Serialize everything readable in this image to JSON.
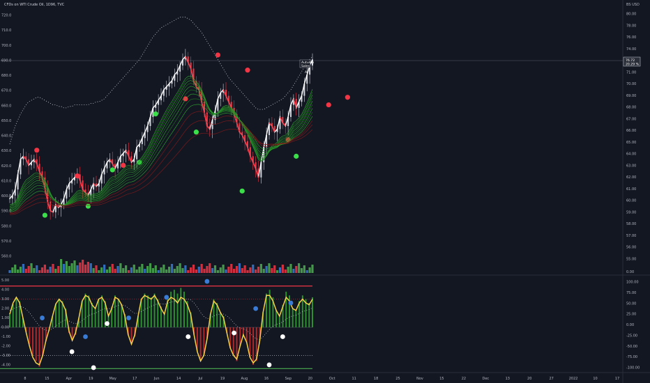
{
  "header": {
    "title": "CFDs on WTI Crude Oil, 1D96, TVC",
    "currency": "BS USD"
  },
  "price_tag": {
    "value": "76.72",
    "change": "20.29 %"
  },
  "annotation": {
    "line1": "Autumn",
    "line2": "Sales",
    "marker": "A"
  },
  "colors": {
    "background": "#131722",
    "price_line": "#ffffff",
    "bull_candle": "#4caf50",
    "bear_candle": "#f23645",
    "green_dot": "#3bdf4a",
    "red_dot": "#f23645",
    "blue_dot": "#3a7bd5",
    "oscillator_line": "#f5d24a",
    "hist_green": "#2e9e2e",
    "hist_red": "#c62828",
    "upper_band": "#f23645",
    "lower_band": "#4caf50"
  },
  "chart_data": [
    {
      "type": "line",
      "panel": "price",
      "ylim": [
        558,
        722
      ],
      "yticks_left": [
        "720.0",
        "710.0",
        "700.0",
        "690.0",
        "680.0",
        "670.0",
        "660.0",
        "650.0",
        "640.0",
        "630.0",
        "620.0",
        "610.0",
        "600.0",
        "590.0",
        "580.0",
        "570.0",
        "560.0"
      ],
      "yticks_right": [
        "80.00",
        "78.00",
        "76.00",
        "74.00",
        "72.00",
        "71.00",
        "70.00",
        "69.00",
        "68.00",
        "67.00",
        "66.00",
        "65.00",
        "64.00",
        "63.00",
        "62.00",
        "61.00",
        "60.00",
        "59.00",
        "58.00",
        "57.00",
        "56.00",
        "55.00"
      ],
      "price": [
        598,
        600,
        604,
        614,
        624,
        626,
        624,
        620,
        622,
        624,
        621,
        616,
        612,
        605,
        596,
        590,
        589,
        594,
        592,
        594,
        598,
        604,
        608,
        610,
        612,
        614,
        610,
        604,
        602,
        600,
        604,
        608,
        606,
        608,
        614,
        618,
        622,
        624,
        621,
        618,
        622,
        626,
        628,
        630,
        626,
        622,
        624,
        632,
        634,
        638,
        642,
        646,
        652,
        658,
        660,
        663,
        666,
        670,
        672,
        674,
        676,
        680,
        682,
        686,
        690,
        692,
        688,
        684,
        676,
        672,
        670,
        662,
        655,
        646,
        644,
        650,
        656,
        664,
        668,
        670,
        666,
        662,
        658,
        654,
        648,
        642,
        640,
        636,
        632,
        626,
        622,
        618,
        612,
        622,
        632,
        640,
        648,
        646,
        642,
        644,
        652,
        648,
        646,
        652,
        660,
        664,
        658,
        662,
        666,
        674,
        680,
        686,
        690
      ],
      "upper_band": [
        634,
        640,
        646,
        650,
        654,
        657,
        660,
        662,
        663,
        664,
        665,
        665,
        664,
        663,
        662,
        661,
        660,
        660,
        659,
        659,
        658,
        658,
        659,
        659,
        660,
        660,
        660,
        660,
        660,
        660,
        661,
        661,
        662,
        662,
        663,
        664,
        666,
        668,
        670,
        672,
        674,
        676,
        678,
        680,
        682,
        684,
        686,
        688,
        690,
        693,
        696,
        699,
        702,
        705,
        707,
        709,
        711,
        712,
        713,
        714,
        715,
        716,
        717,
        718,
        718,
        718,
        717,
        716,
        714,
        712,
        710,
        708,
        705,
        702,
        699,
        696,
        693,
        690,
        687,
        684,
        681,
        678,
        676,
        674,
        672,
        670,
        668,
        666,
        664,
        662,
        660,
        658,
        657,
        657,
        657,
        658,
        659,
        660,
        661,
        662,
        663,
        664,
        666,
        668,
        670,
        673,
        676,
        679,
        682,
        685,
        688,
        690,
        692
      ],
      "dots": {
        "red": [
          [
            10,
            630
          ],
          [
            25,
            613
          ],
          [
            42,
            620
          ],
          [
            65,
            664
          ],
          [
            77,
            693
          ],
          [
            88,
            683
          ],
          [
            103,
            637
          ],
          [
            118,
            660
          ],
          [
            125,
            665
          ]
        ],
        "green": [
          [
            13,
            587
          ],
          [
            29,
            593
          ],
          [
            38,
            617
          ],
          [
            48,
            622
          ],
          [
            54,
            654
          ],
          [
            69,
            642
          ],
          [
            86,
            603
          ],
          [
            106,
            626
          ]
        ]
      },
      "volume_colors": "green,red,blue mixed",
      "volume_ticks": [
        "0.00"
      ]
    },
    {
      "type": "bar",
      "panel": "oscillator",
      "ylim": [
        -4.6,
        5.2
      ],
      "yticks_left": [
        "5.00",
        "4.00",
        "3.00",
        "2.00",
        "1.00",
        "0.00",
        "-1.00",
        "-2.00",
        "-3.00",
        "-4.00"
      ],
      "yticks_right": [
        "100.00",
        "75.00",
        "50.00",
        "25.00",
        "0.00",
        "-25.00",
        "-50.00",
        "-75.00",
        "-100.00"
      ],
      "histogram": [
        1.5,
        2.5,
        3.2,
        2.8,
        1.0,
        -0.5,
        -1.8,
        -3.0,
        -3.6,
        -4.2,
        -3.0,
        -1.5,
        -0.4,
        1.2,
        2.5,
        3.0,
        2.8,
        2.0,
        -0.6,
        -1.4,
        -0.8,
        1.0,
        2.8,
        3.6,
        3.4,
        2.6,
        2.0,
        3.0,
        3.4,
        2.8,
        1.2,
        2.2,
        3.4,
        3.0,
        2.4,
        1.4,
        -0.8,
        -1.8,
        -1.0,
        1.2,
        3.0,
        3.6,
        3.4,
        3.2,
        3.6,
        3.0,
        2.2,
        1.4,
        3.0,
        3.8,
        4.0,
        3.6,
        4.2,
        3.8,
        2.8,
        1.6,
        -0.8,
        -2.6,
        -3.6,
        -3.0,
        -1.2,
        1.4,
        3.0,
        2.6,
        1.6,
        1.2,
        -0.6,
        -2.2,
        -3.0,
        -3.6,
        -2.0,
        -0.8,
        -1.6,
        -3.2,
        -4.0,
        -3.6,
        -1.4,
        1.6,
        3.6,
        4.0,
        3.2,
        1.8,
        1.2,
        2.4,
        3.8,
        3.4,
        2.0,
        1.8,
        2.8,
        3.4,
        3.0,
        2.6,
        3.2
      ],
      "oscillator": [
        1.4,
        2.6,
        3.2,
        2.6,
        1.0,
        -0.6,
        -2.0,
        -3.2,
        -3.8,
        -4.0,
        -3.0,
        -1.4,
        -0.2,
        1.2,
        2.5,
        3.0,
        2.6,
        1.8,
        -0.4,
        -1.4,
        -0.6,
        1.0,
        2.8,
        3.4,
        3.2,
        2.4,
        2.0,
        3.0,
        3.2,
        2.6,
        1.2,
        2.0,
        3.2,
        3.0,
        2.4,
        1.2,
        -0.8,
        -1.8,
        -0.8,
        1.2,
        3.0,
        3.4,
        3.2,
        3.0,
        3.4,
        2.8,
        2.0,
        1.4,
        2.8,
        3.2,
        3.0,
        2.6,
        3.2,
        3.0,
        2.4,
        1.4,
        -0.8,
        -2.6,
        -3.6,
        -3.0,
        -1.2,
        1.4,
        2.8,
        2.4,
        1.6,
        1.0,
        -0.6,
        -2.2,
        -3.0,
        -3.4,
        -2.0,
        -0.8,
        -1.6,
        -3.2,
        -3.8,
        -3.4,
        -1.4,
        1.6,
        3.4,
        3.4,
        2.8,
        1.8,
        1.2,
        2.2,
        3.2,
        2.8,
        2.0,
        1.8,
        2.6,
        3.0,
        2.6,
        2.4,
        3.0
      ],
      "upper_line": 4.4,
      "lower_line": -4.4,
      "dots": {
        "blue": [
          [
            12,
            1.0
          ],
          [
            28,
            -1.0
          ],
          [
            44,
            1.0
          ],
          [
            58,
            3.2
          ],
          [
            73,
            4.9
          ],
          [
            91,
            2.0
          ],
          [
            104,
            2.6
          ]
        ],
        "white": [
          [
            36,
            0.4
          ],
          [
            31,
            -4.3
          ],
          [
            23,
            -2.6
          ],
          [
            66,
            -1.0
          ],
          [
            83,
            -0.6
          ],
          [
            101,
            -1.0
          ],
          [
            96,
            -4.0
          ]
        ]
      }
    }
  ],
  "x_axis": [
    "8",
    "15",
    "Apr",
    "19",
    "May",
    "17",
    "Jun",
    "14",
    "Jul",
    "19",
    "Aug",
    "16",
    "Sep",
    "20",
    "Oct",
    "11",
    "18",
    "25",
    "Nov",
    "15",
    "22",
    "Dec",
    "13",
    "20",
    "27",
    "2022",
    "10",
    "17"
  ]
}
